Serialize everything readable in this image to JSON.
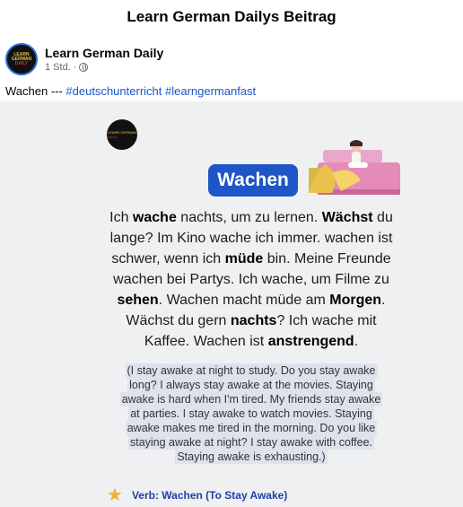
{
  "page": {
    "title": "Learn German Dailys Beitrag"
  },
  "post": {
    "author": "Learn German Daily",
    "time": "1 Std. ·",
    "caption_prefix": "Wachen --- ",
    "hashtags": [
      "#deutschunterricht",
      "#learngermanfast"
    ]
  },
  "logo_text": {
    "line1": "LEARN GERMAN",
    "line2": "DAILY"
  },
  "card": {
    "word_title": "Wachen",
    "german_segments": [
      {
        "t": "Ich ",
        "b": false
      },
      {
        "t": "wache",
        "b": true
      },
      {
        "t": " nachts, um zu lernen. ",
        "b": false
      },
      {
        "t": "Wächst",
        "b": true
      },
      {
        "t": " du lange? Im Kino wache ich immer. wachen ist schwer, wenn ich ",
        "b": false
      },
      {
        "t": "müde",
        "b": true
      },
      {
        "t": " bin. Meine Freunde wachen bei Partys. Ich wache, um Filme zu ",
        "b": false
      },
      {
        "t": "sehen",
        "b": true
      },
      {
        "t": ". Wachen macht müde am ",
        "b": false
      },
      {
        "t": "Morgen",
        "b": true
      },
      {
        "t": ". Wächst du gern ",
        "b": false
      },
      {
        "t": "nachts",
        "b": true
      },
      {
        "t": "? Ich wache mit Kaffee. Wachen ist ",
        "b": false
      },
      {
        "t": "anstrengend",
        "b": true
      },
      {
        "t": ".",
        "b": false
      }
    ],
    "english": "(I stay awake at night to study. Do you stay awake long? I always stay awake at the movies. Staying awake is hard when I'm tired. My friends stay awake at parties. I stay awake to watch movies. Staying awake makes me tired in the morning. Do you like staying awake at night? I stay awake with coffee. Staying awake is exhausting.)",
    "verb_line": "Verb: Wachen (To Stay Awake)"
  },
  "icons": {
    "star": "★",
    "globe": "globe-icon"
  },
  "colors": {
    "badge": "#1f55c7",
    "hashtag": "#1b56c9",
    "star": "#f0b428",
    "verb": "#1f3fa8"
  }
}
